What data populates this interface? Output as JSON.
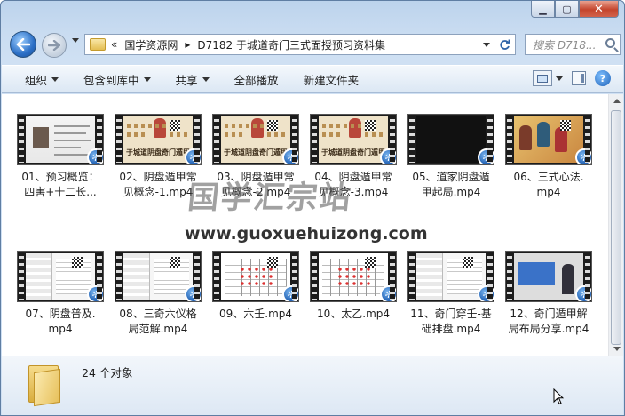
{
  "window": {
    "caption": {
      "minimize_glyph": "▁",
      "maximize_glyph": "▢",
      "close_glyph": "✕"
    }
  },
  "address": {
    "chevron": "«",
    "segments": [
      "国学资源网",
      "D7182 于城道奇门三式面授预习资料集"
    ],
    "separator": "▸",
    "refresh_icon": "refresh-icon"
  },
  "search": {
    "placeholder": "搜索 D718..."
  },
  "toolbar": {
    "organize": "组织",
    "include_library": "包含到库中",
    "share": "共享",
    "play_all": "全部播放",
    "new_folder": "新建文件夹",
    "help_glyph": "?"
  },
  "watermark": {
    "text": "国学汇宗站",
    "url": "www.guoxuehuizong.com"
  },
  "files": [
    {
      "name": "01、预习概览：\n四害+十二长...",
      "thumb": "slide"
    },
    {
      "name": "02、阴盘遁甲常\n见概念-1.mp4",
      "thumb": "cover"
    },
    {
      "name": "03、阴盘遁甲常\n见概念-2.mp4",
      "thumb": "cover"
    },
    {
      "name": "04、阴盘遁甲常\n见概念-3.mp4",
      "thumb": "cover"
    },
    {
      "name": "05、道家阴盘遁\n甲起局.mp4",
      "thumb": "video-blank"
    },
    {
      "name": "06、三式心法.\nmp4",
      "thumb": "paint"
    },
    {
      "name": "07、阴盘普及.\nmp4",
      "thumb": "list"
    },
    {
      "name": "08、三奇六仪格\n局范解.mp4",
      "thumb": "list"
    },
    {
      "name": "09、六壬.mp4",
      "thumb": "table"
    },
    {
      "name": "10、太乙.mp4",
      "thumb": "table"
    },
    {
      "name": "11、奇门穿壬-基\n础排盘.mp4",
      "thumb": "list"
    },
    {
      "name": "12、奇门遁甲解\n局布局分享.mp4",
      "thumb": "video"
    }
  ],
  "cover_title": "于城道阴盘奇门遁甲",
  "details": {
    "count": "24 个对象"
  },
  "colors": {
    "accent": "#1f5fb2",
    "chrome": "#cfe0f3"
  }
}
